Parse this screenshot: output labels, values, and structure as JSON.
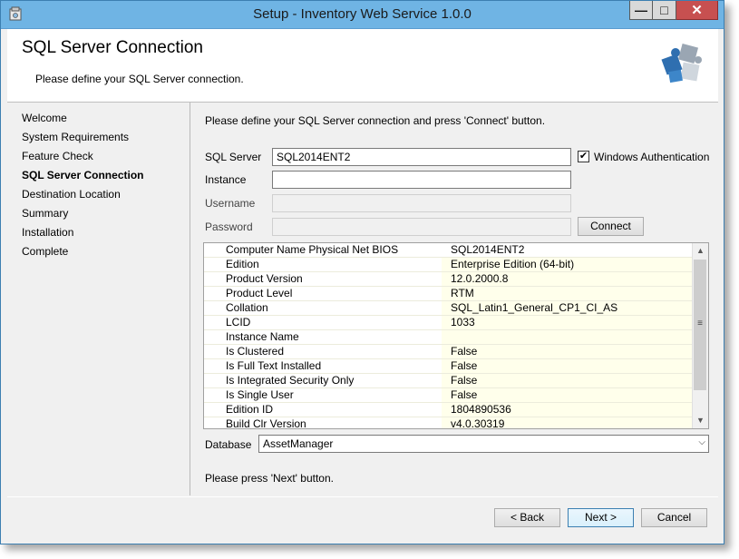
{
  "window": {
    "title": "Setup - Inventory Web Service 1.0.0",
    "minimize_label": "—",
    "maximize_label": "□",
    "close_label": "✕"
  },
  "header": {
    "title": "SQL Server Connection",
    "subtitle": "Please define your SQL Server connection."
  },
  "sidebar": {
    "items": [
      {
        "label": "Welcome"
      },
      {
        "label": "System Requirements"
      },
      {
        "label": "Feature Check"
      },
      {
        "label": "SQL Server Connection",
        "active": true
      },
      {
        "label": "Destination Location"
      },
      {
        "label": "Summary"
      },
      {
        "label": "Installation"
      },
      {
        "label": "Complete"
      }
    ]
  },
  "form": {
    "instruction": "Please define your SQL Server connection and press 'Connect' button.",
    "sql_server_label": "SQL Server",
    "sql_server_value": "SQL2014ENT2",
    "windows_auth_label": "Windows Authentication",
    "windows_auth_checked": true,
    "check_mark": "✔",
    "instance_label": "Instance",
    "instance_value": "",
    "username_label": "Username",
    "username_value": "",
    "password_label": "Password",
    "password_value": "",
    "connect_label": "Connect"
  },
  "properties": {
    "rows": [
      {
        "name": "Computer Name Physical Net BIOS",
        "value": "SQL2014ENT2"
      },
      {
        "name": "Edition",
        "value": "Enterprise Edition (64-bit)"
      },
      {
        "name": "Product Version",
        "value": "12.0.2000.8"
      },
      {
        "name": "Product Level",
        "value": "RTM"
      },
      {
        "name": "Collation",
        "value": "SQL_Latin1_General_CP1_CI_AS"
      },
      {
        "name": "LCID",
        "value": "1033"
      },
      {
        "name": "Instance Name",
        "value": ""
      },
      {
        "name": "Is Clustered",
        "value": "False"
      },
      {
        "name": "Is Full Text Installed",
        "value": "False"
      },
      {
        "name": "Is Integrated Security Only",
        "value": "False"
      },
      {
        "name": "Is Single User",
        "value": "False"
      },
      {
        "name": "Edition ID",
        "value": "1804890536"
      },
      {
        "name": "Build Clr Version",
        "value": "v4.0.30319"
      }
    ],
    "scroll_up": "▲",
    "scroll_down": "▼",
    "scroll_grip": "≡"
  },
  "database": {
    "label": "Database",
    "value": "AssetManager",
    "arrow": "⌵"
  },
  "next_hint": "Please press 'Next' button.",
  "footer": {
    "back_label": "< Back",
    "next_label": "Next >",
    "cancel_label": "Cancel"
  }
}
